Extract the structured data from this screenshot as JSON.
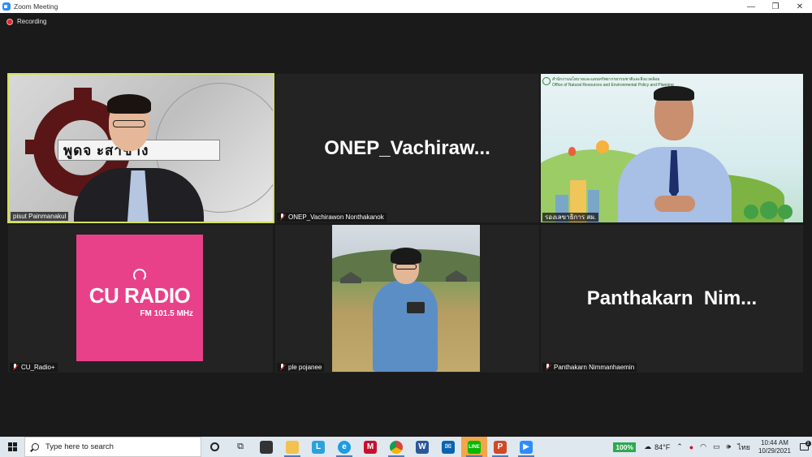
{
  "window": {
    "title": "Zoom Meeting",
    "minimize": "—",
    "restore": "❐",
    "close": "✕"
  },
  "recording": {
    "label": "Recording"
  },
  "participants": [
    {
      "name": "pisut Painmanakul",
      "banner": "พูดจ   ะสาช่าง"
    },
    {
      "name": "ONEP_Vachirawon Nonthakanok",
      "display": "ONEP_Vachiraw..."
    },
    {
      "name": "รองเลขาธิการ สผ.",
      "header_line1": "สำนักงานนโยบายและแผนทรัพยากรธรรมชาติและสิ่งแวดล้อม",
      "header_line2": "Office of Natural Resources and Environmental Policy and Planning"
    },
    {
      "name": "CU_Radio+",
      "logo_main": "CU RADIO",
      "logo_sub": "FM 101.5 MHz"
    },
    {
      "name": "ple pojanee"
    },
    {
      "name": "Panthakarn Nimmanhaemin",
      "display": "Panthakarn  Nim..."
    }
  ],
  "taskbar": {
    "search_placeholder": "Type here to search",
    "apps": [
      "cortana-icon",
      "task-view-icon",
      "store-icon",
      "file-explorer-icon",
      "lync-icon",
      "edge-icon",
      "mcafee-icon",
      "chrome-icon",
      "word-icon",
      "outlook-icon",
      "line-icon",
      "powerpoint-icon",
      "zoom-icon"
    ],
    "battery": "100%",
    "temperature": "84°F",
    "language": "ไทย",
    "time": "10:44 AM",
    "date": "10/29/2021",
    "notification_count": "2"
  },
  "colors": {
    "active_speaker": "#d4e157",
    "cu_radio_pink": "#e8418a",
    "recording_red": "#e02828"
  }
}
